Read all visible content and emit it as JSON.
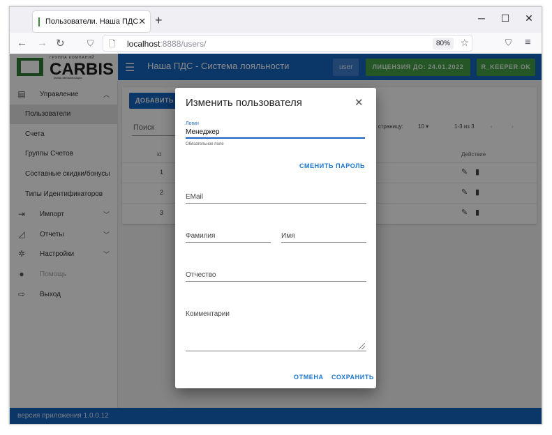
{
  "browser": {
    "tab_title": "Пользователи. Наша ПДС",
    "url_host": "localhost",
    "url_path": ":8888/users/",
    "zoom": "80%"
  },
  "app": {
    "logo_small": "ГРУППА КОМПАНИЙ",
    "logo_text": "CARBIS",
    "logo_sub": "умная автоматизация",
    "title": "Наша ПДС - Система лояльности",
    "user_label": "user",
    "license_label": "ЛИЦЕНЗИЯ ДО: 24.01.2022",
    "rkeeper_label": "R_KEEPER OK",
    "footer": "версия приложения 1.0.0.12"
  },
  "sidebar": {
    "management": "Управление",
    "sub": [
      "Пользователи",
      "Счета",
      "Группы Счетов",
      "Составные скидки/бонусы",
      "Типы Идентификаторов"
    ],
    "import": "Импорт",
    "reports": "Отчеты",
    "settings": "Настройки",
    "help": "Помощь",
    "logout": "Выход"
  },
  "table": {
    "add_button": "ДОБАВИТЬ П",
    "search": "Поиск",
    "per_page_label": "а страницу:",
    "per_page_value": "10",
    "range": "1-3 из 3",
    "col_id": "id",
    "col_action": "Действие",
    "rows": [
      "1",
      "2",
      "3"
    ]
  },
  "dialog": {
    "title": "Изменить пользователя",
    "login_label": "Логин",
    "login_value": "Менеджер",
    "login_hint": "Обязательное поле",
    "change_password": "СМЕНИТЬ ПАРОЛЬ",
    "email": "EMail",
    "last_name": "Фамилия",
    "first_name": "Имя",
    "patronymic": "Отчество",
    "comments": "Комментарии",
    "cancel": "ОТМЕНА",
    "save": "СОХРАНИТЬ"
  }
}
